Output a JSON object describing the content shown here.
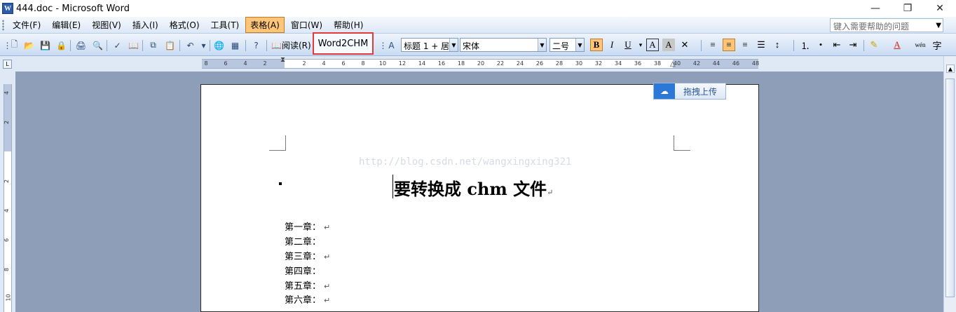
{
  "window": {
    "title": "444.doc - Microsoft Word",
    "app_icon_letter": "W",
    "minimize": "—",
    "restore": "❐",
    "close": "✕"
  },
  "menu": {
    "items": [
      "文件(F)",
      "编辑(E)",
      "视图(V)",
      "插入(I)",
      "格式(O)",
      "工具(T)",
      "表格(A)",
      "窗口(W)",
      "帮助(H)"
    ],
    "active": "表格(A)",
    "help_placeholder": "键入需要帮助的问题"
  },
  "toolbar": {
    "read_label": "阅读(R)",
    "word2chm_label": "Word2CHM",
    "style_value": "标题 1 + 居",
    "font_value": "宋体",
    "size_value": "二号",
    "bold": "B",
    "italic": "I",
    "underline": "U"
  },
  "ruler": {
    "ticks": [
      "8",
      "6",
      "4",
      "2",
      "2",
      "4",
      "6",
      "8",
      "10",
      "12",
      "14",
      "16",
      "18",
      "20",
      "22",
      "24",
      "26",
      "28",
      "30",
      "32",
      "34",
      "36",
      "38",
      "40",
      "42",
      "44",
      "46",
      "48"
    ],
    "vticks": [
      "4",
      "2",
      "2",
      "4",
      "6",
      "8",
      "10"
    ]
  },
  "document": {
    "watermark": "http://blog.csdn.net/wangxingxing321",
    "upload_label": "拖拽上传",
    "title": "要转换成 chm 文件",
    "chapters": [
      "第一章：",
      "第二章：",
      "第三章：",
      "第四章：",
      "第五章：",
      "第六章："
    ],
    "chapters_mark": [
      "↵",
      "",
      "↵",
      "",
      "↵",
      "↵"
    ],
    "para_mark": "↵"
  }
}
